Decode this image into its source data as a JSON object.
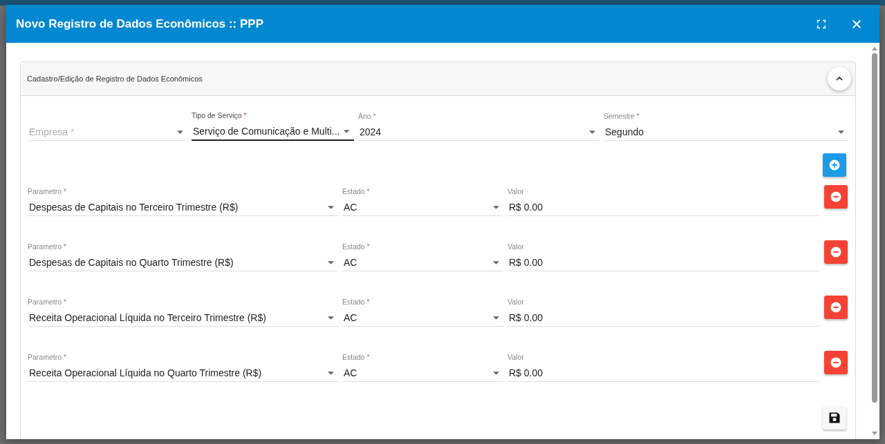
{
  "dialog": {
    "title": "Novo Registro de Dados Econômicos :: PPP"
  },
  "panel": {
    "title": "Cadastro/Edição de Registro de Dados Econômicos",
    "expanded": true
  },
  "filters": [
    {
      "label": "Empresa",
      "required_mark": "*",
      "focused": false
    },
    {
      "label": "Tipo de Serviço",
      "required_mark": "*",
      "value": "Serviço de Comunicação e Multi...",
      "focused": true
    },
    {
      "label": "Ano",
      "required_mark": "*",
      "value": "2024",
      "focused": false
    },
    {
      "label": "Semestre",
      "required_mark": "*",
      "value": "Segundo",
      "focused": false
    }
  ],
  "parameters": [
    {
      "parametro": {
        "label": "Parametro",
        "required_mark": "*",
        "value": "Despesas de Capitais no Terceiro Trimestre (R$)"
      },
      "estado": {
        "label": "Estado",
        "required_mark": "*",
        "value": "AC"
      },
      "valor": {
        "label": "Valor",
        "value": "R$ 0.00"
      }
    },
    {
      "parametro": {
        "label": "Parametro",
        "required_mark": "*",
        "value": "Despesas de Capitais no Quarto Trimestre (R$)"
      },
      "estado": {
        "label": "Estado",
        "required_mark": "*",
        "value": "AC"
      },
      "valor": {
        "label": "Valor",
        "value": "R$ 0.00"
      }
    },
    {
      "parametro": {
        "label": "Parametro",
        "required_mark": "*",
        "value": "Receita Operacional Líquida no Terceiro Trimestre (R$)"
      },
      "estado": {
        "label": "Estado",
        "required_mark": "*",
        "value": "AC"
      },
      "valor": {
        "label": "Valor",
        "value": "R$ 0.00"
      }
    },
    {
      "parametro": {
        "label": "Parametro",
        "required_mark": "*",
        "value": "Receita Operacional Líquida no Quarto Trimestre (R$)"
      },
      "estado": {
        "label": "Estado",
        "required_mark": "*",
        "value": "AC"
      },
      "valor": {
        "label": "Valor",
        "value": "R$ 0.00"
      }
    }
  ]
}
